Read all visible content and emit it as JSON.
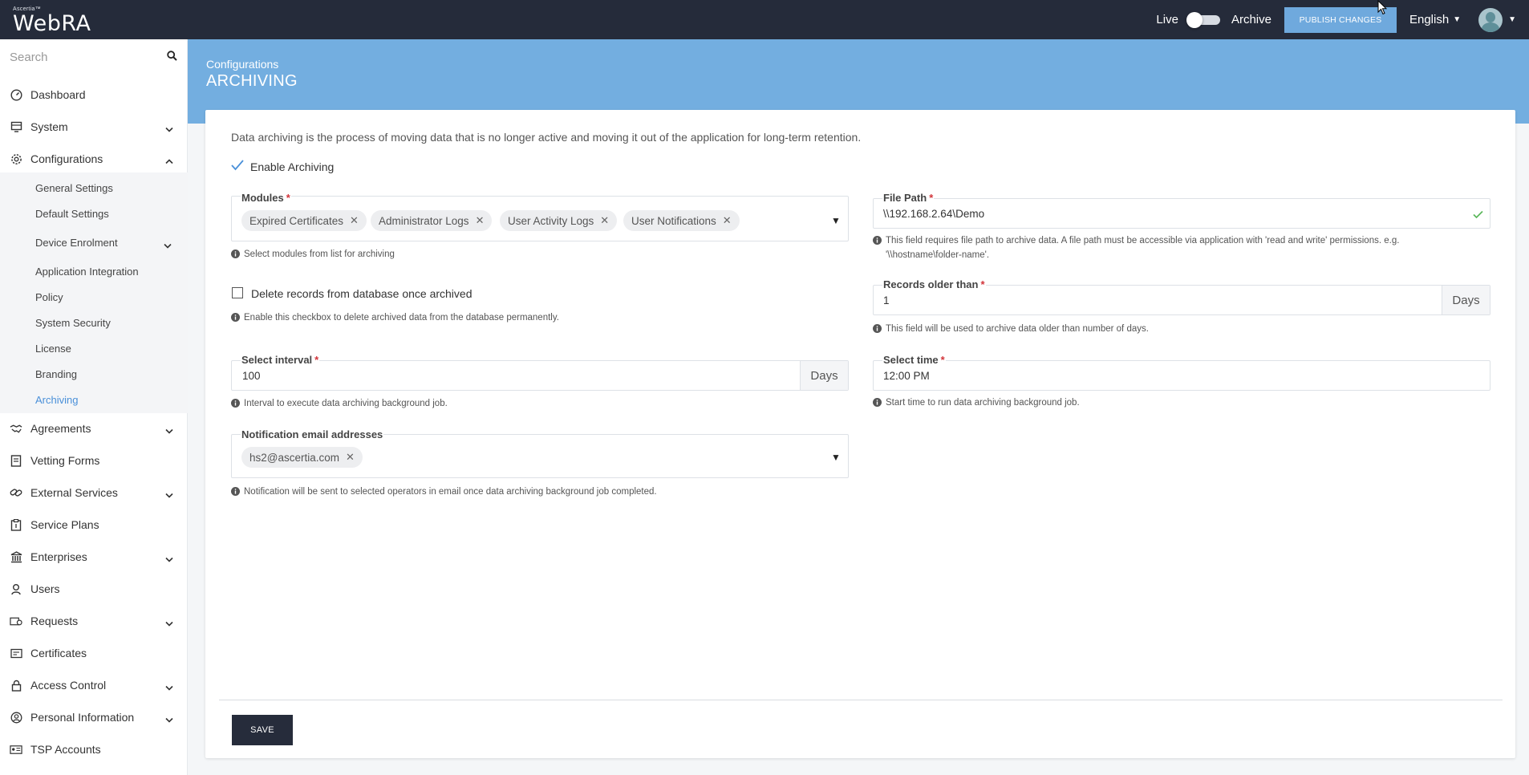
{
  "brand": {
    "small": "Ascertia™",
    "name": "WebRA"
  },
  "topbar": {
    "live_label": "Live",
    "archive_label": "Archive",
    "publish_label": "PUBLISH CHANGES",
    "language": "English"
  },
  "sidebar": {
    "search_placeholder": "Search",
    "items": [
      {
        "label": "Dashboard",
        "icon": "gauge-icon"
      },
      {
        "label": "System",
        "icon": "server-icon"
      },
      {
        "label": "Configurations",
        "icon": "gear-icon"
      },
      {
        "label": "Agreements",
        "icon": "handshake-icon"
      },
      {
        "label": "Vetting Forms",
        "icon": "form-icon"
      },
      {
        "label": "External Services",
        "icon": "link-icon"
      },
      {
        "label": "Service Plans",
        "icon": "plan-icon"
      },
      {
        "label": "Enterprises",
        "icon": "bank-icon"
      },
      {
        "label": "Users",
        "icon": "user-icon"
      },
      {
        "label": "Requests",
        "icon": "request-icon"
      },
      {
        "label": "Certificates",
        "icon": "certificate-icon"
      },
      {
        "label": "Access Control",
        "icon": "lock-icon"
      },
      {
        "label": "Personal Information",
        "icon": "person-icon"
      },
      {
        "label": "TSP Accounts",
        "icon": "id-card-icon"
      }
    ],
    "config_sub": [
      "General Settings",
      "Default Settings",
      "Device Enrolment",
      "Application Integration",
      "Policy",
      "System Security",
      "License",
      "Branding",
      "Archiving"
    ]
  },
  "page": {
    "breadcrumb": "Configurations",
    "title": "ARCHIVING"
  },
  "form": {
    "description": "Data archiving is the process of moving data that is no longer active and moving it out of the application for long-term retention.",
    "enable_label": "Enable Archiving",
    "modules": {
      "label": "Modules",
      "chips": [
        "Expired Certificates",
        "Administrator Logs",
        "User Activity Logs",
        "User Notifications"
      ],
      "hint": "Select modules from list for archiving"
    },
    "file_path": {
      "label": "File Path",
      "value": "\\\\192.168.2.64\\Demo",
      "hint_line1": "This field requires file path to archive data. A file path must be accessible via application with 'read and write' permissions. e.g.",
      "hint_line2": "'\\\\hostname\\folder-name'."
    },
    "delete_records": {
      "label": "Delete records from database once archived",
      "hint": "Enable this checkbox to delete archived data from the database permanently."
    },
    "records_older": {
      "label": "Records older than",
      "value": "1",
      "unit": "Days",
      "hint": "This field will be used to archive data older than number of days."
    },
    "interval": {
      "label": "Select interval",
      "value": "100",
      "unit": "Days",
      "hint": "Interval to execute data archiving background job."
    },
    "time": {
      "label": "Select time",
      "value": "12:00 PM",
      "hint": "Start time to run data archiving background job."
    },
    "notification": {
      "label": "Notification email addresses",
      "chips": [
        "hs2@ascertia.com"
      ],
      "hint": "Notification will be sent to selected operators in email once data archiving background job completed."
    },
    "save_label": "SAVE"
  },
  "colors": {
    "topbar": "#252b3a",
    "banner": "#73aee0",
    "accent": "#4a90d9",
    "required": "#d2343a"
  }
}
